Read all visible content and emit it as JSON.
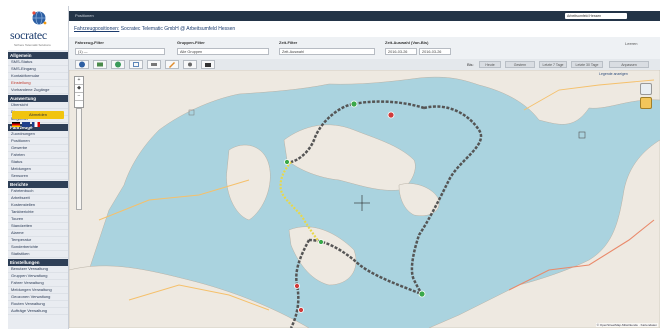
{
  "brand": {
    "name": "socratec",
    "tagline": "Sichere Telematik Solutions"
  },
  "sidebar": {
    "sections": [
      {
        "title": "Allgemein",
        "items": [
          "SMS-Status",
          "SMS-Eingang",
          "Kontaktformular",
          "Einstellung",
          "Vorhandene Zugänge"
        ]
      },
      {
        "title": "Auswertung",
        "items": [
          "Übersicht",
          "Diagramme",
          "Mitglieder"
        ]
      },
      {
        "title": "Fahrzeuge",
        "items": [
          "Zuordnungen",
          "Positionen",
          "Gewerbe",
          "Fahrten",
          "Status",
          "Meldungen",
          "Sensoren"
        ]
      },
      {
        "title": "Berichte",
        "items": [
          "Fahrtenbuch",
          "Arbeitszeit",
          "Kostenstellen",
          "Tankberichte",
          "Touren",
          "Standzeiten",
          "Alarme",
          "Temperatur",
          "Sonderberichte",
          "Statistiken"
        ]
      },
      {
        "title": "Einstellungen",
        "items": [
          "Benutzer Verwaltung",
          "Gruppen Verwaltung",
          "Fahrer Verwaltung",
          "Meldungen Verwaltung",
          "Geozonen Verwaltung",
          "Routen Verwaltung",
          "Aufträge Verwaltung"
        ]
      }
    ],
    "abmelden": "Abmelden"
  },
  "topbar": {
    "title": "Positionen",
    "select_value": "Arbeitsumfeld Hessen"
  },
  "breadcrumb": {
    "link": "Fahrzeugpositionen:",
    "text": "Socratec Telematic GmbH @ Arbeitsumfeld Hessen"
  },
  "filters": {
    "fahrzeug_label": "Fahrzeug-Filter",
    "fahrzeug_value": "(1) —",
    "gruppen_label": "Gruppen-Filter",
    "gruppen_value": "Alle Gruppen",
    "zeit_label": "Zeit-Filter",
    "zeit_value": "Zeit-Auswahl",
    "zeitauswahl_label": "Zeit-Auswahl (Von-Bis)",
    "von": "2016-03-26",
    "bis": "2016-03-26",
    "clear": "Leeren"
  },
  "toolbar": {
    "bis_label": "Bis:",
    "segments": [
      "Heute",
      "Gestern",
      "Letzte 7 Tage",
      "Letzte 30 Tage",
      "Anpassen"
    ],
    "legend_link": "Legende anzeigen"
  },
  "map": {
    "attribution": "© OpenStreetMap-Mitwirkende · Kartendaten"
  }
}
